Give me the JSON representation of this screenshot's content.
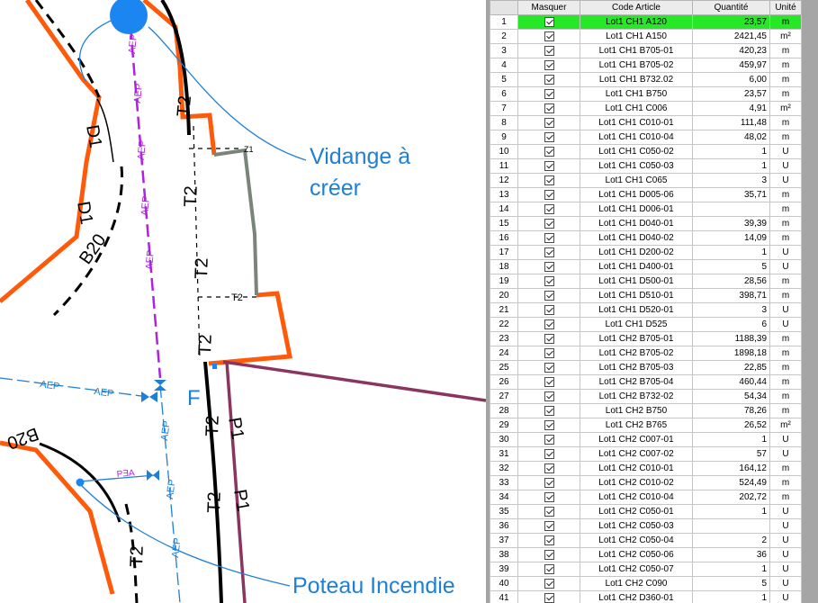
{
  "cad": {
    "annotations": {
      "vidange": [
        "Vidange à",
        "créer"
      ],
      "poteau": "Poteau Incendie",
      "f_marker": "F"
    },
    "labels": {
      "aep": "AEP",
      "aep_rev": "PƎA",
      "t2": "T2",
      "b20": "B20",
      "p1": "P1",
      "d1": "D1",
      "z1": "Z1"
    },
    "colors": {
      "road": "#ff5a0a",
      "pipe_aep": "#b021e0",
      "pipe_p1": "#8a3560",
      "gray_pipe": "#7a857a",
      "blue": "#1e7fd6",
      "hydrant": "#1b86f0",
      "text_blue": "#1e7fd6"
    }
  },
  "grid": {
    "columns": [
      "Masquer",
      "Code Article",
      "Quantité",
      "Unité"
    ],
    "selected_row": 1,
    "rows": [
      {
        "n": "1",
        "code": "Lot1 CH1 A120",
        "qty": "23,57",
        "unit": "m"
      },
      {
        "n": "2",
        "code": "Lot1 CH1 A150",
        "qty": "2421,45",
        "unit": "m²"
      },
      {
        "n": "3",
        "code": "Lot1 CH1 B705-01",
        "qty": "420,23",
        "unit": "m"
      },
      {
        "n": "4",
        "code": "Lot1 CH1 B705-02",
        "qty": "459,97",
        "unit": "m"
      },
      {
        "n": "5",
        "code": "Lot1 CH1 B732.02",
        "qty": "6,00",
        "unit": "m"
      },
      {
        "n": "6",
        "code": "Lot1 CH1 B750",
        "qty": "23,57",
        "unit": "m"
      },
      {
        "n": "7",
        "code": "Lot1 CH1 C006",
        "qty": "4,91",
        "unit": "m²"
      },
      {
        "n": "8",
        "code": "Lot1 CH1 C010-01",
        "qty": "111,48",
        "unit": "m"
      },
      {
        "n": "9",
        "code": "Lot1 CH1 C010-04",
        "qty": "48,02",
        "unit": "m"
      },
      {
        "n": "10",
        "code": "Lot1 CH1 C050-02",
        "qty": "1",
        "unit": "U"
      },
      {
        "n": "11",
        "code": "Lot1 CH1 C050-03",
        "qty": "1",
        "unit": "U"
      },
      {
        "n": "12",
        "code": "Lot1 CH1 C065",
        "qty": "3",
        "unit": "U"
      },
      {
        "n": "13",
        "code": "Lot1 CH1 D005-06",
        "qty": "35,71",
        "unit": "m"
      },
      {
        "n": "14",
        "code": "Lot1 CH1 D006-01",
        "qty": "",
        "unit": "m"
      },
      {
        "n": "15",
        "code": "Lot1 CH1 D040-01",
        "qty": "39,39",
        "unit": "m"
      },
      {
        "n": "16",
        "code": "Lot1 CH1 D040-02",
        "qty": "14,09",
        "unit": "m"
      },
      {
        "n": "17",
        "code": "Lot1 CH1 D200-02",
        "qty": "1",
        "unit": "U"
      },
      {
        "n": "18",
        "code": "Lot1 CH1 D400-01",
        "qty": "5",
        "unit": "U"
      },
      {
        "n": "19",
        "code": "Lot1 CH1 D500-01",
        "qty": "28,56",
        "unit": "m"
      },
      {
        "n": "20",
        "code": "Lot1 CH1 D510-01",
        "qty": "398,71",
        "unit": "m"
      },
      {
        "n": "21",
        "code": "Lot1 CH1 D520-01",
        "qty": "3",
        "unit": "U"
      },
      {
        "n": "22",
        "code": "Lot1 CH1 D525",
        "qty": "6",
        "unit": "U"
      },
      {
        "n": "23",
        "code": "Lot1 CH2 B705-01",
        "qty": "1188,39",
        "unit": "m"
      },
      {
        "n": "24",
        "code": "Lot1 CH2 B705-02",
        "qty": "1898,18",
        "unit": "m"
      },
      {
        "n": "25",
        "code": "Lot1 CH2 B705-03",
        "qty": "22,85",
        "unit": "m"
      },
      {
        "n": "26",
        "code": "Lot1 CH2 B705-04",
        "qty": "460,44",
        "unit": "m"
      },
      {
        "n": "27",
        "code": "Lot1 CH2 B732-02",
        "qty": "54,34",
        "unit": "m"
      },
      {
        "n": "28",
        "code": "Lot1 CH2 B750",
        "qty": "78,26",
        "unit": "m"
      },
      {
        "n": "29",
        "code": "Lot1 CH2 B765",
        "qty": "26,52",
        "unit": "m²"
      },
      {
        "n": "30",
        "code": "Lot1 CH2 C007-01",
        "qty": "1",
        "unit": "U"
      },
      {
        "n": "31",
        "code": "Lot1 CH2 C007-02",
        "qty": "57",
        "unit": "U"
      },
      {
        "n": "32",
        "code": "Lot1 CH2 C010-01",
        "qty": "164,12",
        "unit": "m"
      },
      {
        "n": "33",
        "code": "Lot1 CH2 C010-02",
        "qty": "524,49",
        "unit": "m"
      },
      {
        "n": "34",
        "code": "Lot1 CH2 C010-04",
        "qty": "202,72",
        "unit": "m"
      },
      {
        "n": "35",
        "code": "Lot1 CH2 C050-01",
        "qty": "1",
        "unit": "U"
      },
      {
        "n": "36",
        "code": "Lot1 CH2 C050-03",
        "qty": "",
        "unit": "U"
      },
      {
        "n": "37",
        "code": "Lot1 CH2 C050-04",
        "qty": "2",
        "unit": "U"
      },
      {
        "n": "38",
        "code": "Lot1 CH2 C050-06",
        "qty": "36",
        "unit": "U"
      },
      {
        "n": "39",
        "code": "Lot1 CH2 C050-07",
        "qty": "1",
        "unit": "U"
      },
      {
        "n": "40",
        "code": "Lot1 CH2 C090",
        "qty": "5",
        "unit": "U"
      },
      {
        "n": "41",
        "code": "Lot1 CH2 D360-01",
        "qty": "1",
        "unit": "U"
      }
    ]
  }
}
